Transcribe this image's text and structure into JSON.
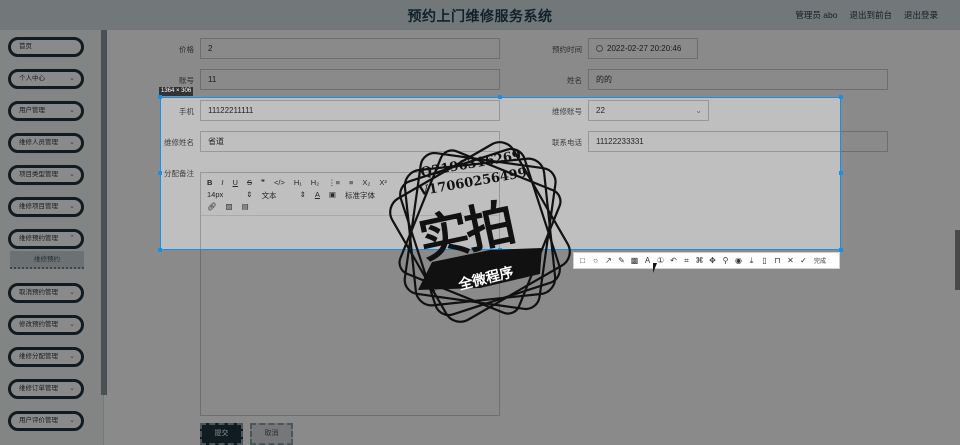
{
  "header": {
    "title": "预约上门维修服务系统",
    "admin_label": "管理员 abo",
    "frontend_label": "退出到前台",
    "logout_label": "退出登录"
  },
  "sidebar": {
    "items": [
      {
        "label": "首页",
        "has_chevron": false
      },
      {
        "label": "个人中心",
        "has_chevron": true
      },
      {
        "label": "用户管理",
        "has_chevron": true
      },
      {
        "label": "维修人员管理",
        "has_chevron": true
      },
      {
        "label": "项目类型管理",
        "has_chevron": true
      },
      {
        "label": "维修项目管理",
        "has_chevron": true
      },
      {
        "label": "维修预约管理",
        "has_chevron": true
      },
      {
        "label": "取消预约管理",
        "has_chevron": true
      },
      {
        "label": "修改预约管理",
        "has_chevron": true
      },
      {
        "label": "维修分配管理",
        "has_chevron": true
      },
      {
        "label": "维修订单管理",
        "has_chevron": true
      },
      {
        "label": "用户评价管理",
        "has_chevron": true
      }
    ],
    "sub_item": "维修预约"
  },
  "form": {
    "price_label": "价格",
    "price_value": "2",
    "booking_time_label": "预约时间",
    "booking_time_value": "2022-02-27 20:20:46",
    "account_label": "账号",
    "account_value": "11",
    "name_label": "姓名",
    "name_value": "的的",
    "phone_label": "手机",
    "phone_value": "11122211111",
    "repair_account_label": "维修账号",
    "repair_account_value": "22",
    "repair_name_label": "维修姓名",
    "repair_name_value": "省道",
    "contact_phone_label": "联系电话",
    "contact_phone_value": "11122233331",
    "notes_label": "分配备注",
    "submit_label": "提交",
    "cancel_label": "取消"
  },
  "editor_toolbar": {
    "row1": [
      "B",
      "I",
      "U",
      "S",
      "❞",
      "</>",
      "H₁",
      "H₂",
      "⋮≡",
      "≡",
      "X₂",
      "X²"
    ],
    "font_size": "14px",
    "text_style": "文本",
    "font_family": "标准字体",
    "row3_icons": [
      "link-icon",
      "image-icon",
      "video-icon"
    ]
  },
  "capture": {
    "size_tag": "1364 × 306",
    "done_label": "完成",
    "tools": [
      "rect-icon",
      "ellipse-icon",
      "arrow-icon",
      "pen-icon",
      "mosaic-icon",
      "text-icon",
      "number-icon",
      "undo-icon",
      "ocr-icon",
      "translate-icon",
      "color-picker-icon",
      "pin-icon",
      "record-icon",
      "save-icon",
      "phone-icon",
      "bookmark-icon",
      "close-icon",
      "check-icon"
    ]
  },
  "watermark": {
    "line1": "Q2196316269",
    "line2": "V17060256499",
    "big": "实拍",
    "ribbon": "全微程序"
  },
  "colors": {
    "header_bg": "#d3dfe2",
    "menu_border": "#1f3540",
    "accent": "#1e8fe0"
  }
}
